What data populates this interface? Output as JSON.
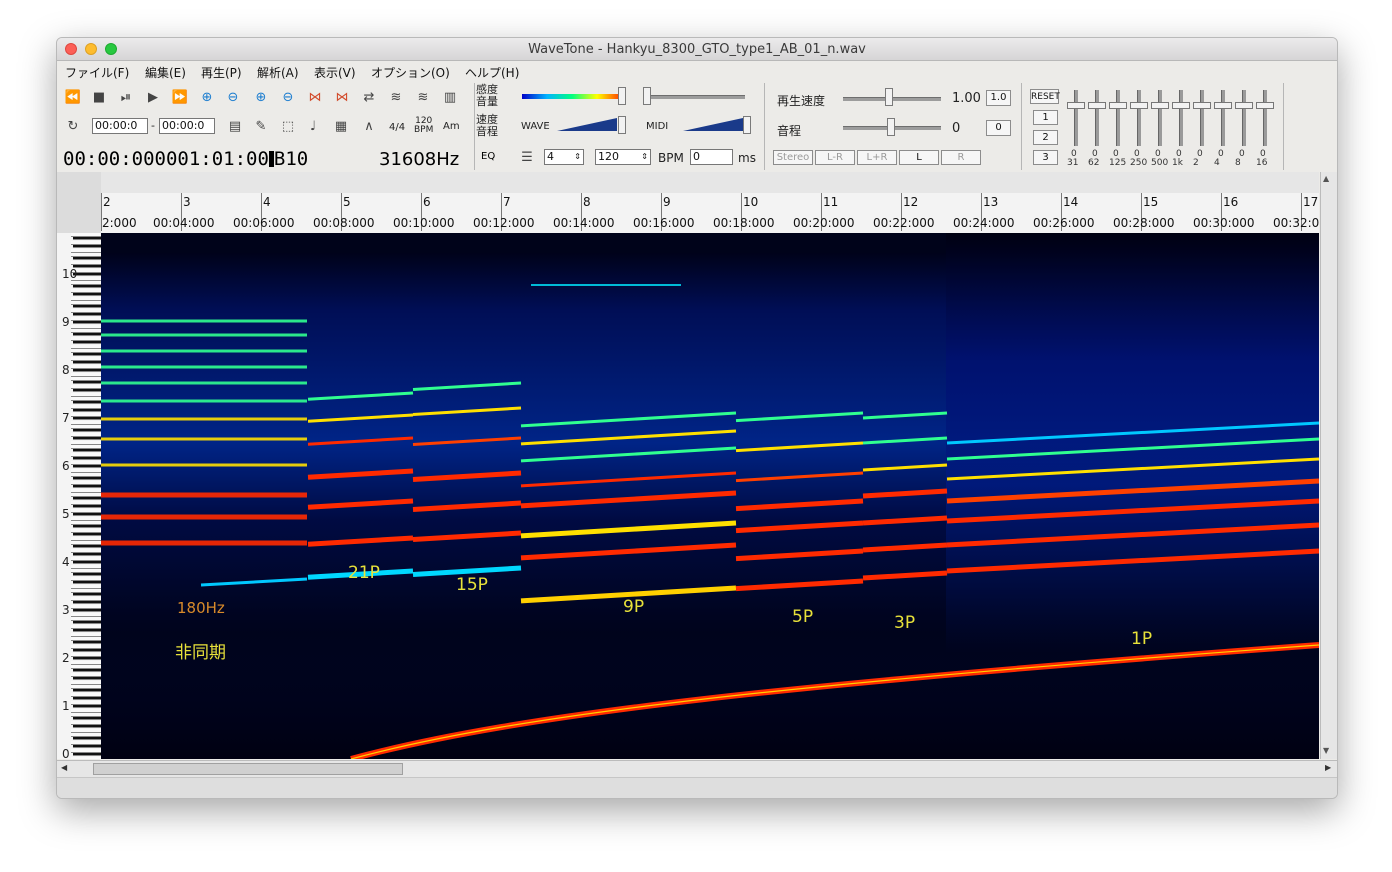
{
  "window": {
    "title": "WaveTone - Hankyu_8300_GTO_type1_AB_01_n.wav"
  },
  "menu": [
    "ファイル(F)",
    "編集(E)",
    "再生(P)",
    "解析(A)",
    "表示(V)",
    "オプション(O)",
    "ヘルプ(H)"
  ],
  "toolbar": {
    "time_start": "00:00:0",
    "time_end": "00:00:0",
    "meter": "4/4",
    "tempo_icon_label": "120\nBPM",
    "chord_label": "Am",
    "timecode": "00:00:000001:01:00",
    "note": "B10",
    "frequency": "31608Hz",
    "eq_label": "EQ"
  },
  "gain": {
    "sensitivity_label": "感度\n音量",
    "speed_pitch_label": "速度\n音程",
    "wave_label": "WAVE",
    "midi_label": "MIDI"
  },
  "beat": {
    "beats": "4",
    "bpm_value": "120",
    "bpm_label": "BPM",
    "ms_value": "0",
    "ms_label": "ms"
  },
  "channels": [
    "Stereo",
    "L-R",
    "L+R",
    "L",
    "R"
  ],
  "playback": {
    "speed_label": "再生速度",
    "speed_value": "1.00",
    "speed_reset": "1.0",
    "pitch_label": "音程",
    "pitch_value": "0",
    "pitch_reset": "0"
  },
  "eq": {
    "reset_label": "RESET",
    "presets": [
      "1",
      "2",
      "3"
    ],
    "bands": [
      {
        "freq": "31",
        "value": "0"
      },
      {
        "freq": "62",
        "value": "0"
      },
      {
        "freq": "125",
        "value": "0"
      },
      {
        "freq": "250",
        "value": "0"
      },
      {
        "freq": "500",
        "value": "0"
      },
      {
        "freq": "1k",
        "value": "0"
      },
      {
        "freq": "2",
        "value": "0"
      },
      {
        "freq": "4",
        "value": "0"
      },
      {
        "freq": "8",
        "value": "0"
      },
      {
        "freq": "16",
        "value": "0"
      }
    ]
  },
  "ruler": {
    "bars": [
      "2",
      "3",
      "4",
      "5",
      "6",
      "7",
      "8",
      "9",
      "10",
      "11",
      "12",
      "13",
      "14",
      "15",
      "16",
      "17"
    ],
    "times": [
      "2:000",
      "00:04:000",
      "00:06:000",
      "00:08:000",
      "00:10:000",
      "00:12:000",
      "00:14:000",
      "00:16:000",
      "00:18:000",
      "00:20:000",
      "00:22:000",
      "00:24:000",
      "00:26:000",
      "00:28:000",
      "00:30:000",
      "00:32:0"
    ]
  },
  "octaves": [
    "10",
    "9",
    "8",
    "7",
    "6",
    "5",
    "4",
    "3",
    "2",
    "1",
    "0"
  ],
  "annotations": {
    "freq_note": "180Hz",
    "async": "非同期",
    "p21": "21P",
    "p15": "15P",
    "p9": "9P",
    "p5": "5P",
    "p3": "3P",
    "p1": "1P"
  },
  "colors": {
    "spectrum_bg": "#00031a",
    "annotation_yellow": "#e8e23a",
    "annotation_orange": "#d88a2a"
  }
}
